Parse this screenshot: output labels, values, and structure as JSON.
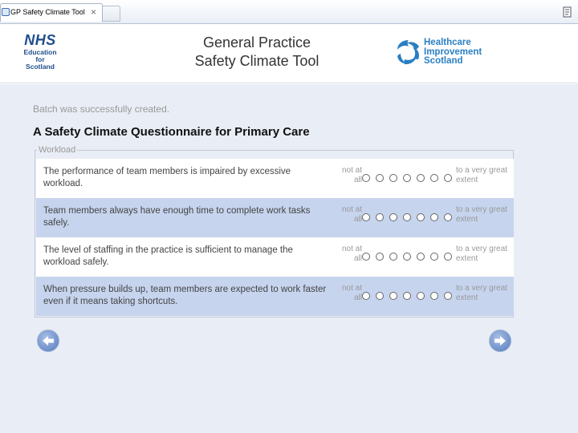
{
  "browser": {
    "tab_title": "GP Safety Climate Tool",
    "tab_close": "×"
  },
  "header": {
    "nhs_logo": {
      "mark": "NHS",
      "lines": [
        "Education",
        "for",
        "Scotland"
      ]
    },
    "title_line1": "General Practice",
    "title_line2": "Safety Climate Tool",
    "his_logo": {
      "lines": [
        "Healthcare",
        "Improvement",
        "Scotland"
      ],
      "color": "#2a7fc3"
    }
  },
  "main": {
    "status_message": "Batch was successfully created.",
    "title": "A Safety Climate Questionnaire for Primary Care",
    "section": {
      "legend": "Workload",
      "scale_low": "not at all",
      "scale_high": "to a very great extent",
      "questions": [
        {
          "text": "The performance of team members is impaired by excessive workload."
        },
        {
          "text": "Team members always have enough time to complete work tasks safely."
        },
        {
          "text": "The level of staffing in the practice is sufficient to manage the workload safely."
        },
        {
          "text": "When pressure builds up, team members are expected to work faster even if it means taking shortcuts."
        }
      ]
    },
    "nav": {
      "prev_icon": "arrow-left-icon",
      "next_icon": "arrow-right-icon"
    }
  },
  "colors": {
    "row_alt": "#c6d4ee",
    "nhs_blue": "#1f4e8c",
    "content_bg": "#e9edf5"
  }
}
